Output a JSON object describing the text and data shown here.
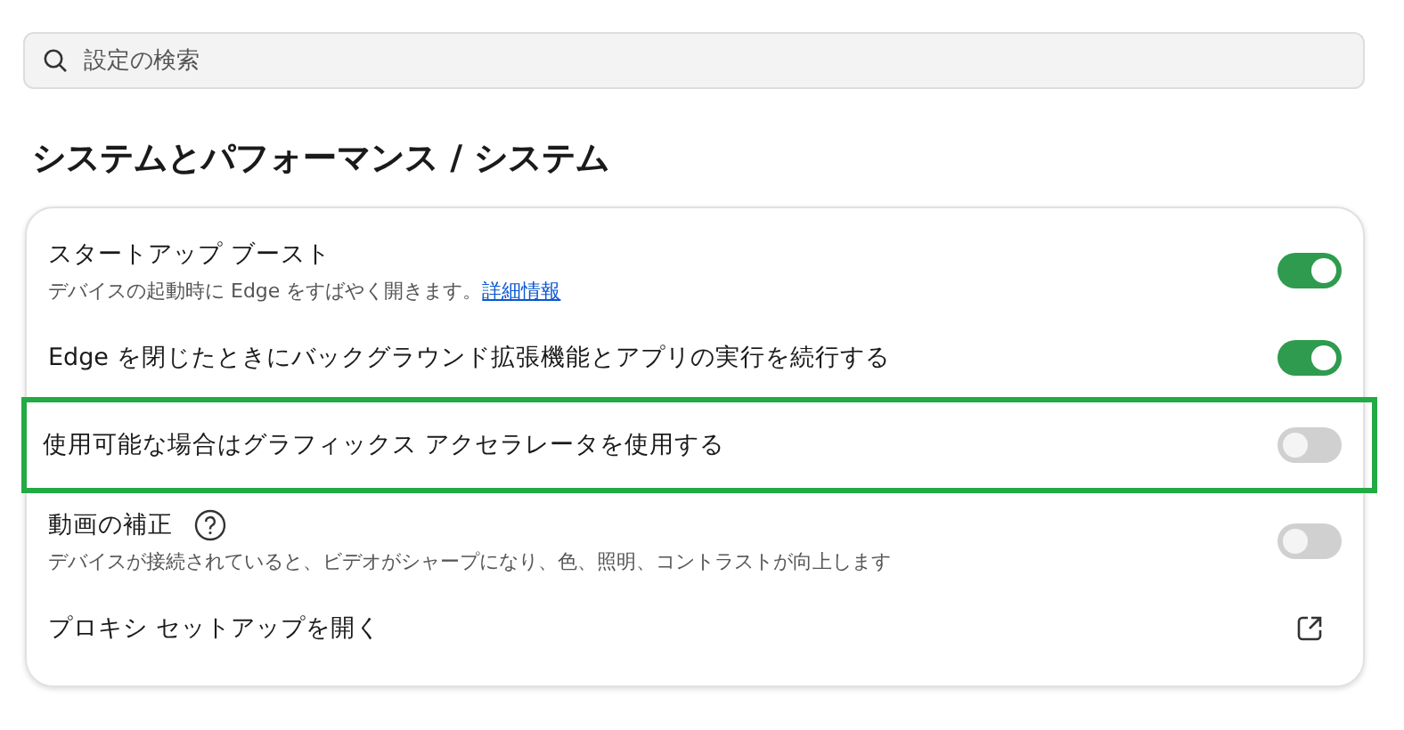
{
  "search": {
    "placeholder": "設定の検索"
  },
  "heading": "システムとパフォーマンス / システム",
  "rows": [
    {
      "kind": "toggle",
      "title": "スタートアップ ブースト",
      "description": "デバイスの起動時に Edge をすばやく開きます。",
      "link": "詳細情報",
      "on": true,
      "highlighted": false
    },
    {
      "kind": "toggle",
      "title": "Edge を閉じたときにバックグラウンド拡張機能とアプリの実行を続行する",
      "on": true,
      "highlighted": false
    },
    {
      "kind": "toggle",
      "title": "使用可能な場合はグラフィックス アクセラレータを使用する",
      "on": false,
      "highlighted": true
    },
    {
      "kind": "toggle",
      "title": "動画の補正",
      "help": true,
      "description": "デバイスが接続されていると、ビデオがシャープになり、色、照明、コントラストが向上します",
      "on": false,
      "highlighted": false
    },
    {
      "kind": "external",
      "title": "プロキシ セットアップを開く",
      "highlighted": false
    }
  ]
}
